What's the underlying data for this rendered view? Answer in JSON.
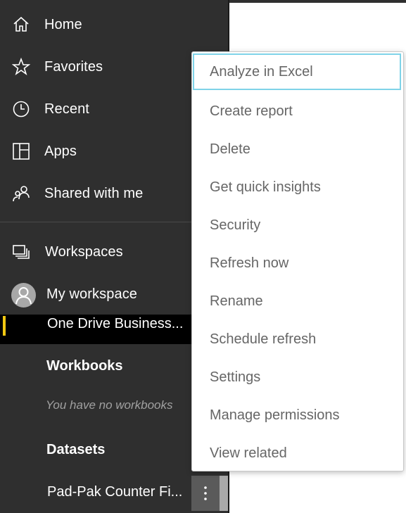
{
  "nav": {
    "home": "Home",
    "favorites": "Favorites",
    "recent": "Recent",
    "apps": "Apps",
    "shared": "Shared with me",
    "workspaces": "Workspaces",
    "my_workspace": "My workspace"
  },
  "workspace": {
    "selected_item": "One Drive Business...",
    "workbooks_heading": "Workbooks",
    "workbooks_empty": "You have no workbooks",
    "datasets_heading": "Datasets",
    "dataset_item": "Pad-Pak Counter Fi...",
    "selected_accent_color": "#f2c811"
  },
  "context_menu": {
    "items": [
      "Analyze in Excel",
      "Create report",
      "Delete",
      "Get quick insights",
      "Security",
      "Refresh now",
      "Rename",
      "Schedule refresh",
      "Settings",
      "Manage permissions",
      "View related"
    ],
    "focused_index": 0
  },
  "icons": {
    "home": "home-icon",
    "favorites": "star-icon",
    "recent": "clock-icon",
    "apps": "apps-icon",
    "shared": "shared-people-icon",
    "workspaces": "workspaces-icon",
    "avatar": "user-avatar-icon",
    "more": "more-vertical-icon"
  }
}
